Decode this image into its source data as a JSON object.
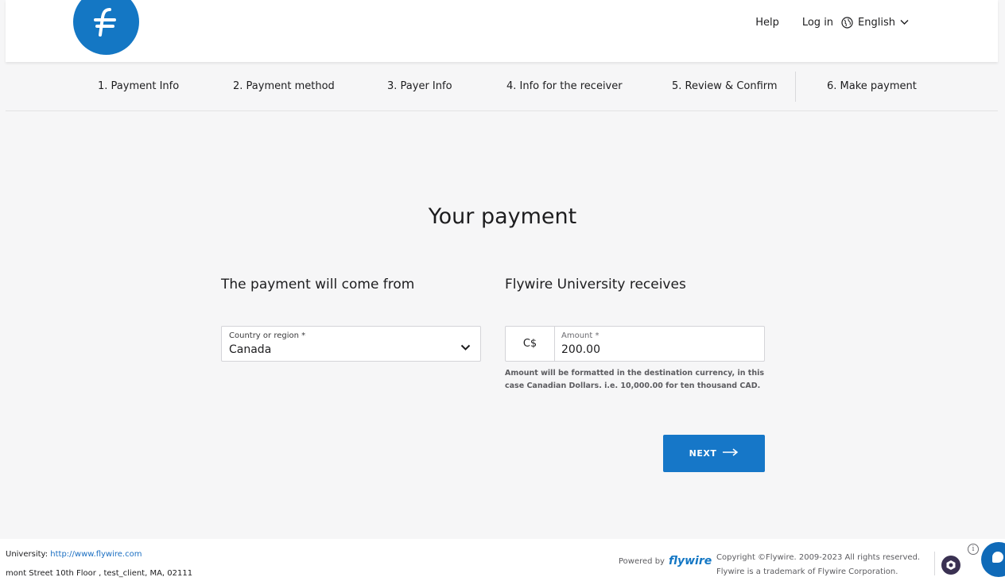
{
  "header": {
    "help_label": "Help",
    "login_label": "Log in",
    "language_label": "English"
  },
  "steps": [
    {
      "label": "1. Payment Info"
    },
    {
      "label": "2. Payment method"
    },
    {
      "label": "3. Payer Info"
    },
    {
      "label": "4. Info for the receiver"
    },
    {
      "label": "5. Review & Confirm"
    },
    {
      "label": "6. Make payment"
    }
  ],
  "main": {
    "title": "Your payment",
    "from_heading": "The payment will come from",
    "receives_heading": "Flywire University receives",
    "country": {
      "label": "Country or region *",
      "value": "Canada"
    },
    "amount": {
      "currency": "C$",
      "label": "Amount *",
      "value": "200.00",
      "hint": "Amount will be formatted in the destination currency, in this case Canadian Dollars. i.e. 10,000.00 for ten thousand CAD."
    },
    "next_label": "NEXT"
  },
  "footer": {
    "university_prefix": "University:",
    "university_link": "http://www.flywire.com",
    "address": "mont Street 10th Floor , test_client, MA, 02111",
    "powered_by": "Powered by",
    "brand": "flywire",
    "copyright_line1": "Copyright ©Flywire. 2009-2023 All rights reserved.",
    "copyright_line2": "Flywire is a trademark of Flywire Corporation."
  },
  "colors": {
    "brand_blue": "#1477c4",
    "button_blue": "#1677c8",
    "background": "#f6f6f7"
  },
  "icons": [
    "flywire-logo-icon",
    "globe-icon",
    "chevron-down-icon",
    "arrow-right-icon",
    "info-icon",
    "chat-icon",
    "badge-icon"
  ]
}
